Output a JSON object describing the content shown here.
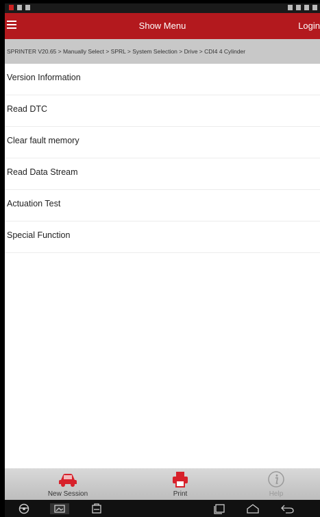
{
  "header": {
    "title": "Show Menu",
    "login_label": "Login"
  },
  "breadcrumb": "SPRINTER V20.65 > Manually Select > SPRL > System Selection > Drive > CDI4 4 Cylinder",
  "menu": {
    "items": [
      {
        "label": "Version Information"
      },
      {
        "label": "Read DTC"
      },
      {
        "label": "Clear fault memory"
      },
      {
        "label": "Read Data Stream"
      },
      {
        "label": "Actuation Test"
      },
      {
        "label": "Special Function"
      }
    ]
  },
  "toolbar": {
    "new_session_label": "New Session",
    "print_label": "Print",
    "help_label": "Help",
    "new_session_icon": "car-icon",
    "print_icon": "printer-icon",
    "help_icon": "info-icon"
  },
  "colors": {
    "title_bar": "#b3191e",
    "breadcrumb_bg": "#c8c8c8",
    "accent_icon": "#d7212b",
    "toolbar_bg": "#cfcfcf"
  }
}
